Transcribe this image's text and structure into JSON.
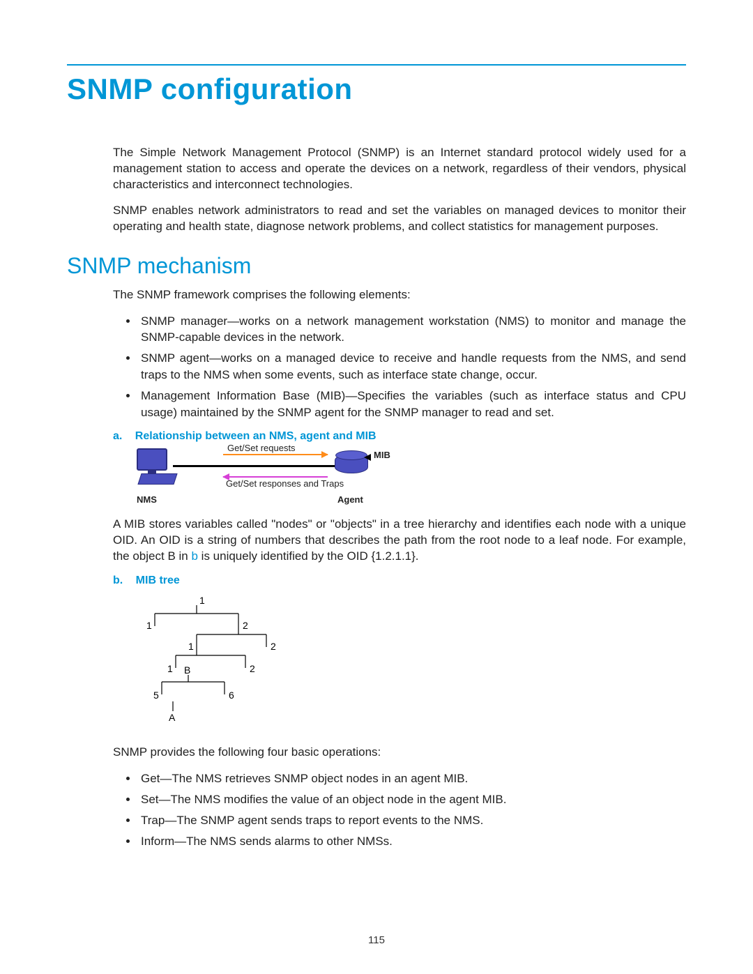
{
  "title": "SNMP configuration",
  "intro": {
    "p1": "The Simple Network Management Protocol (SNMP) is an Internet standard protocol widely used for a management station to access and operate the devices on a network, regardless of their vendors, physical characteristics and interconnect technologies.",
    "p2": "SNMP enables network administrators to read and set the variables on managed devices to monitor their operating and health state, diagnose network problems, and collect statistics for management purposes."
  },
  "section": {
    "heading": "SNMP mechanism",
    "lead": "The SNMP framework comprises the following elements:",
    "elements": [
      "SNMP manager—works on a network management workstation (NMS) to monitor and manage the SNMP-capable devices in the network.",
      "SNMP agent—works on a managed device to receive and handle requests from the NMS, and send traps to the NMS when some events, such as interface state change, occur.",
      "Management Information Base (MIB)—Specifies the variables (such as interface status and CPU usage) maintained by the SNMP agent for the SNMP manager to read and set."
    ],
    "fig_a": {
      "label": "a.",
      "title": "Relationship between an NMS, agent and MIB",
      "req_label": "Get/Set requests",
      "resp_label": "Get/Set responses\nand Traps",
      "nms_label": "NMS",
      "agent_label": "Agent",
      "mib_label": "MIB"
    },
    "mib_para_pre": "A MIB stores variables called \"nodes\" or \"objects\" in a tree hierarchy and identifies each node with a unique OID. An OID is a string of numbers that describes the path from the root node to a leaf node. For example, the object B in ",
    "mib_para_link": "b",
    "mib_para_post": " is uniquely identified by the OID {1.2.1.1}.",
    "fig_b": {
      "label": "b.",
      "title": "MIB tree",
      "nodes": {
        "root": "1",
        "l1_left": "1",
        "l1_right": "2",
        "l2_left": "1",
        "l2_right": "2",
        "l3_left": "1",
        "l3_right": "2",
        "B": "B",
        "five": "5",
        "six": "6",
        "A": "A"
      }
    },
    "ops_lead": "SNMP provides the following four basic operations:",
    "ops": [
      "Get—The NMS retrieves SNMP object nodes in an agent MIB.",
      "Set—The NMS modifies the value of an object node in the agent MIB.",
      "Trap—The SNMP agent sends traps to report events to the NMS.",
      "Inform—The NMS sends alarms to other NMSs."
    ]
  },
  "page_number": "115"
}
